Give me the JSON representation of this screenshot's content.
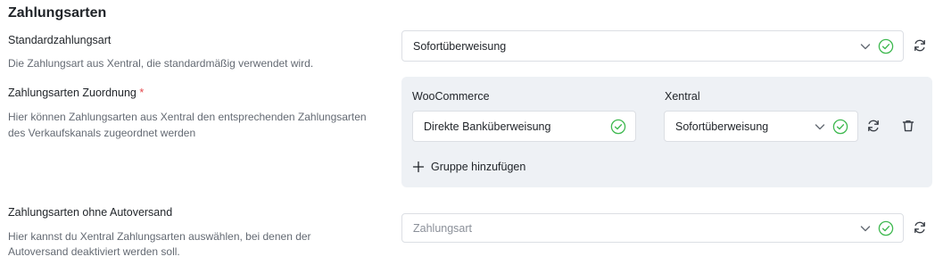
{
  "section": {
    "title": "Zahlungsarten"
  },
  "default_payment": {
    "label": "Standardzahlungsart",
    "description": "Die Zahlungsart aus Xentral, die standardmäßig verwendet wird.",
    "select_value": "Sofortüberweisung"
  },
  "mapping": {
    "label": "Zahlungsarten Zuordnung",
    "required_mark": "*",
    "description_line1": "Hier können Zahlungsarten aus Xentral den entsprechenden Zahlungsarten",
    "description_line2": "des Verkaufskanals zugeordnet werden",
    "col_left": "WooCommerce",
    "col_right": "Xentral",
    "row": {
      "woo_value": "Direkte Banküberweisung",
      "xentral_value": "Sofortüberweisung"
    },
    "add_group_label": "Gruppe hinzufügen"
  },
  "no_autoversand": {
    "label": "Zahlungsarten ohne Autoversand",
    "description_line1": "Hier kannst du Xentral Zahlungsarten auswählen, bei denen der",
    "description_line2": "Autoversand deaktiviert werden soll.",
    "placeholder": "Zahlungsart"
  },
  "colors": {
    "success": "#3fb950",
    "border": "#dcdfe4",
    "panel_bg": "#eef1f5"
  },
  "icons": [
    "chevron-down-icon",
    "check-circle-icon",
    "refresh-icon",
    "trash-icon",
    "plus-icon"
  ]
}
